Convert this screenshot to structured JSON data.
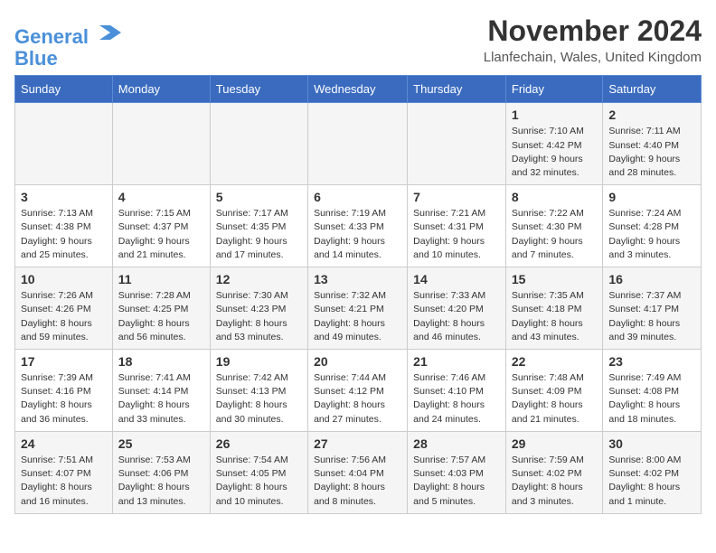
{
  "app": {
    "logo_line1": "General",
    "logo_line2": "Blue"
  },
  "header": {
    "month": "November 2024",
    "location": "Llanfechain, Wales, United Kingdom"
  },
  "weekdays": [
    "Sunday",
    "Monday",
    "Tuesday",
    "Wednesday",
    "Thursday",
    "Friday",
    "Saturday"
  ],
  "weeks": [
    [
      {
        "day": "",
        "info": ""
      },
      {
        "day": "",
        "info": ""
      },
      {
        "day": "",
        "info": ""
      },
      {
        "day": "",
        "info": ""
      },
      {
        "day": "",
        "info": ""
      },
      {
        "day": "1",
        "info": "Sunrise: 7:10 AM\nSunset: 4:42 PM\nDaylight: 9 hours\nand 32 minutes."
      },
      {
        "day": "2",
        "info": "Sunrise: 7:11 AM\nSunset: 4:40 PM\nDaylight: 9 hours\nand 28 minutes."
      }
    ],
    [
      {
        "day": "3",
        "info": "Sunrise: 7:13 AM\nSunset: 4:38 PM\nDaylight: 9 hours\nand 25 minutes."
      },
      {
        "day": "4",
        "info": "Sunrise: 7:15 AM\nSunset: 4:37 PM\nDaylight: 9 hours\nand 21 minutes."
      },
      {
        "day": "5",
        "info": "Sunrise: 7:17 AM\nSunset: 4:35 PM\nDaylight: 9 hours\nand 17 minutes."
      },
      {
        "day": "6",
        "info": "Sunrise: 7:19 AM\nSunset: 4:33 PM\nDaylight: 9 hours\nand 14 minutes."
      },
      {
        "day": "7",
        "info": "Sunrise: 7:21 AM\nSunset: 4:31 PM\nDaylight: 9 hours\nand 10 minutes."
      },
      {
        "day": "8",
        "info": "Sunrise: 7:22 AM\nSunset: 4:30 PM\nDaylight: 9 hours\nand 7 minutes."
      },
      {
        "day": "9",
        "info": "Sunrise: 7:24 AM\nSunset: 4:28 PM\nDaylight: 9 hours\nand 3 minutes."
      }
    ],
    [
      {
        "day": "10",
        "info": "Sunrise: 7:26 AM\nSunset: 4:26 PM\nDaylight: 8 hours\nand 59 minutes."
      },
      {
        "day": "11",
        "info": "Sunrise: 7:28 AM\nSunset: 4:25 PM\nDaylight: 8 hours\nand 56 minutes."
      },
      {
        "day": "12",
        "info": "Sunrise: 7:30 AM\nSunset: 4:23 PM\nDaylight: 8 hours\nand 53 minutes."
      },
      {
        "day": "13",
        "info": "Sunrise: 7:32 AM\nSunset: 4:21 PM\nDaylight: 8 hours\nand 49 minutes."
      },
      {
        "day": "14",
        "info": "Sunrise: 7:33 AM\nSunset: 4:20 PM\nDaylight: 8 hours\nand 46 minutes."
      },
      {
        "day": "15",
        "info": "Sunrise: 7:35 AM\nSunset: 4:18 PM\nDaylight: 8 hours\nand 43 minutes."
      },
      {
        "day": "16",
        "info": "Sunrise: 7:37 AM\nSunset: 4:17 PM\nDaylight: 8 hours\nand 39 minutes."
      }
    ],
    [
      {
        "day": "17",
        "info": "Sunrise: 7:39 AM\nSunset: 4:16 PM\nDaylight: 8 hours\nand 36 minutes."
      },
      {
        "day": "18",
        "info": "Sunrise: 7:41 AM\nSunset: 4:14 PM\nDaylight: 8 hours\nand 33 minutes."
      },
      {
        "day": "19",
        "info": "Sunrise: 7:42 AM\nSunset: 4:13 PM\nDaylight: 8 hours\nand 30 minutes."
      },
      {
        "day": "20",
        "info": "Sunrise: 7:44 AM\nSunset: 4:12 PM\nDaylight: 8 hours\nand 27 minutes."
      },
      {
        "day": "21",
        "info": "Sunrise: 7:46 AM\nSunset: 4:10 PM\nDaylight: 8 hours\nand 24 minutes."
      },
      {
        "day": "22",
        "info": "Sunrise: 7:48 AM\nSunset: 4:09 PM\nDaylight: 8 hours\nand 21 minutes."
      },
      {
        "day": "23",
        "info": "Sunrise: 7:49 AM\nSunset: 4:08 PM\nDaylight: 8 hours\nand 18 minutes."
      }
    ],
    [
      {
        "day": "24",
        "info": "Sunrise: 7:51 AM\nSunset: 4:07 PM\nDaylight: 8 hours\nand 16 minutes."
      },
      {
        "day": "25",
        "info": "Sunrise: 7:53 AM\nSunset: 4:06 PM\nDaylight: 8 hours\nand 13 minutes."
      },
      {
        "day": "26",
        "info": "Sunrise: 7:54 AM\nSunset: 4:05 PM\nDaylight: 8 hours\nand 10 minutes."
      },
      {
        "day": "27",
        "info": "Sunrise: 7:56 AM\nSunset: 4:04 PM\nDaylight: 8 hours\nand 8 minutes."
      },
      {
        "day": "28",
        "info": "Sunrise: 7:57 AM\nSunset: 4:03 PM\nDaylight: 8 hours\nand 5 minutes."
      },
      {
        "day": "29",
        "info": "Sunrise: 7:59 AM\nSunset: 4:02 PM\nDaylight: 8 hours\nand 3 minutes."
      },
      {
        "day": "30",
        "info": "Sunrise: 8:00 AM\nSunset: 4:02 PM\nDaylight: 8 hours\nand 1 minute."
      }
    ]
  ]
}
